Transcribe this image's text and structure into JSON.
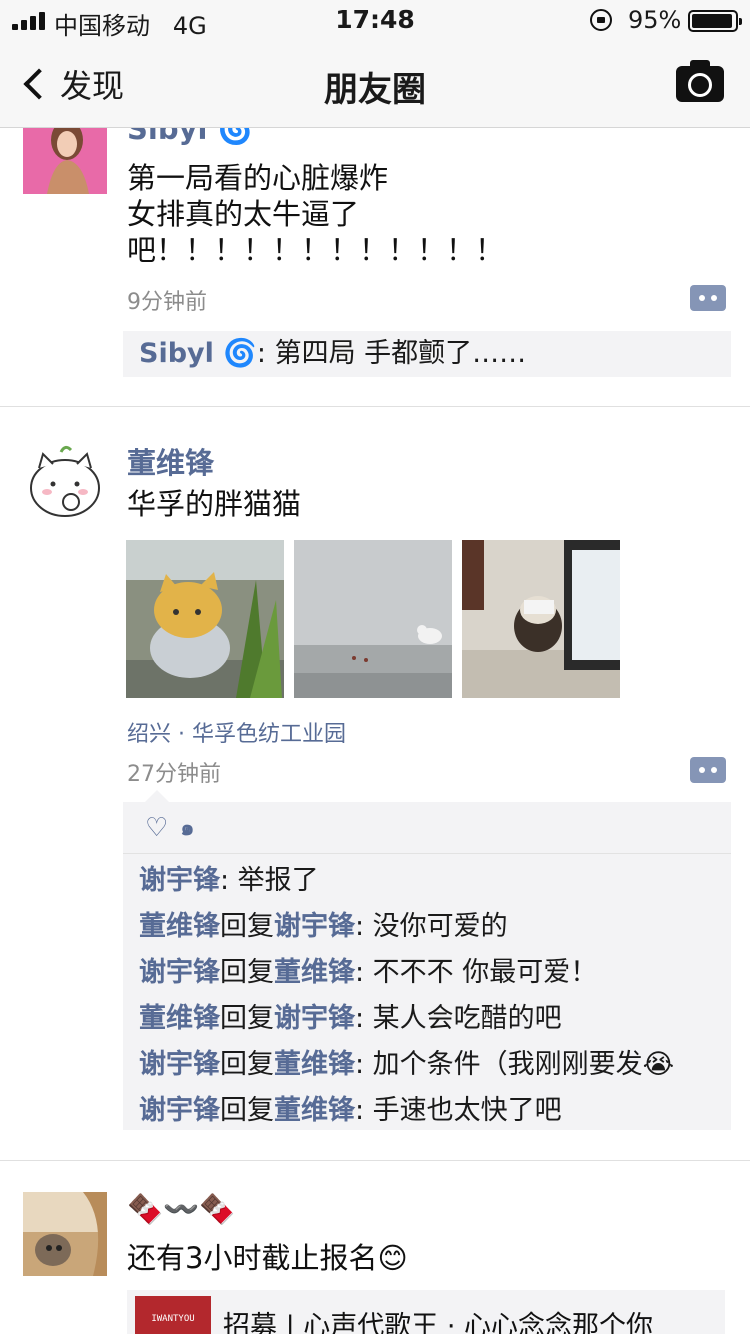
{
  "status": {
    "carrier": "中国移动",
    "network": "4G",
    "time": "17:48",
    "battery": "95%",
    "battery_level": 0.95
  },
  "nav": {
    "back_label": "发现",
    "title": "朋友圈"
  },
  "posts": [
    {
      "author": "Sibyl 🌀",
      "lines": [
        "第一局看的心脏爆炸",
        "女排真的太牛逼了吧！！！！！！！！！！！！"
      ],
      "time": "9分钟前",
      "comments": [
        {
          "name": "Sibyl 🌀",
          "text": ": 第四局 手都颤了……"
        }
      ]
    },
    {
      "author": "董维锋",
      "text": "华孚的胖猫猫",
      "location": "绍兴 · 华孚色纺工业园",
      "time": "27分钟前",
      "likes": {
        "icon": "heart-icon",
        "count": "๑"
      },
      "comments": [
        {
          "name": "谢宇锋",
          "reply_word": "",
          "reply_to": "",
          "text": ": 举报了"
        },
        {
          "name": "董维锋",
          "reply_word": "回复",
          "reply_to": "谢宇锋",
          "text": ": 没你可爱的"
        },
        {
          "name": "谢宇锋",
          "reply_word": "回复",
          "reply_to": "董维锋",
          "text": ": 不不不 你最可爱！"
        },
        {
          "name": "董维锋",
          "reply_word": "回复",
          "reply_to": "谢宇锋",
          "text": ": 某人会吃醋的吧"
        },
        {
          "name": "谢宇锋",
          "reply_word": "回复",
          "reply_to": "董维锋",
          "text": ": 加个条件（我刚刚要发😭"
        },
        {
          "name": "谢宇锋",
          "reply_word": "回复",
          "reply_to": "董维锋",
          "text": ": 手速也太快了吧"
        }
      ]
    },
    {
      "author": "🍫〰️🍫",
      "text": "还有3小时截止报名😊",
      "share": {
        "thumb_label": "IWANTYOU",
        "title": "招募 | 心声代歌王 · 心心念念那个你"
      }
    }
  ]
}
